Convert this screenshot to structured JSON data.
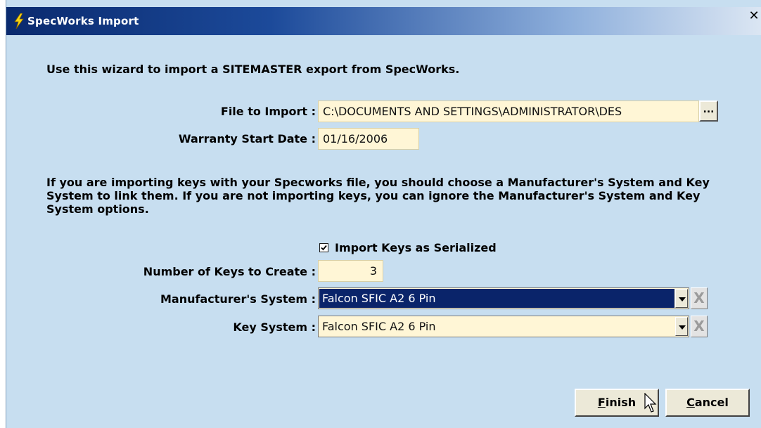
{
  "window": {
    "title": "SpecWorks Import",
    "close_glyph": "✕"
  },
  "intro_text": "Use this wizard to import a SITEMASTER export from SpecWorks.",
  "file_to_import": {
    "label": "File to Import :",
    "value": "C:\\DOCUMENTS AND SETTINGS\\ADMINISTRATOR\\DES",
    "browse_label": "..."
  },
  "warranty_start_date": {
    "label": "Warranty Start Date :",
    "value": "01/16/2006"
  },
  "info_text": "If you are importing keys with your Specworks file, you should choose a Manufacturer's System and Key System to link them.  If you are not importing keys, you can ignore the Manufacturer's System and Key System options.",
  "import_keys_serialized": {
    "label": "Import Keys as Serialized",
    "checked": true
  },
  "number_of_keys": {
    "label": "Number of Keys to Create :",
    "value": "3"
  },
  "manufacturers_system": {
    "label": "Manufacturer's System :",
    "value": "Falcon SFIC A2 6 Pin",
    "clear_glyph": "X"
  },
  "key_system": {
    "label": "Key System :",
    "value": "Falcon SFIC A2 6 Pin",
    "clear_glyph": "X"
  },
  "buttons": {
    "finish_first": "F",
    "finish_rest": "inish",
    "cancel_first": "C",
    "cancel_rest": "ancel"
  },
  "icons": {
    "title_icon": "lightning-bolt-icon",
    "cursor": "arrow-cursor-icon"
  },
  "colors": {
    "background": "#c7def0",
    "field_background": "#fff6d6",
    "selection": "#0a246a"
  }
}
